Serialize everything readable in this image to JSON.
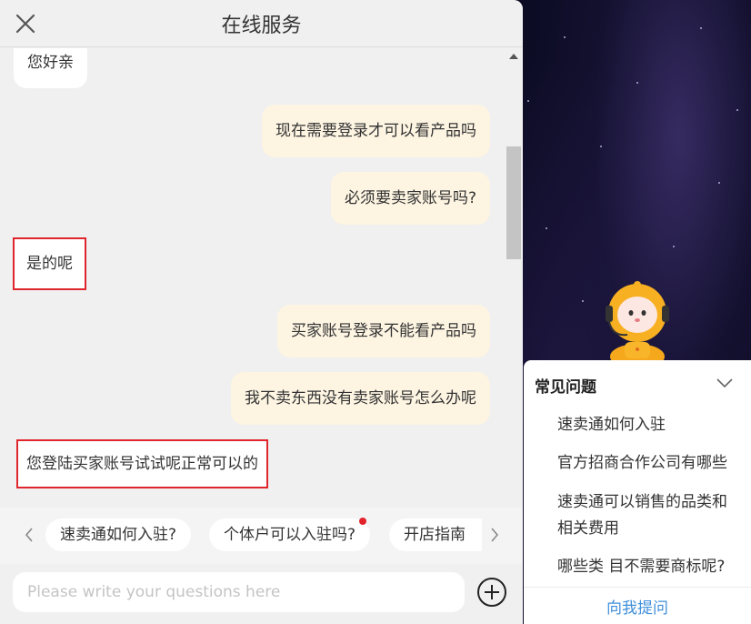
{
  "header": {
    "title": "在线服务",
    "close_icon": "close-icon"
  },
  "messages": [
    {
      "side": "left",
      "text": "您好亲",
      "highlighted": false
    },
    {
      "side": "right",
      "text": "现在需要登录才可以看产品吗",
      "highlighted": false
    },
    {
      "side": "right",
      "text": "必须要卖家账号吗?",
      "highlighted": false
    },
    {
      "side": "left",
      "text": "是的呢",
      "highlighted": true
    },
    {
      "side": "right",
      "text": "买家账号登录不能看产品吗",
      "highlighted": false
    },
    {
      "side": "right",
      "text": "我不卖东西没有卖家账号怎么办呢",
      "highlighted": false
    },
    {
      "side": "left",
      "text": "您登陆买家账号试试呢正常可以的",
      "highlighted": true
    }
  ],
  "quick_replies": {
    "prev_icon": "chevron-left-icon",
    "next_icon": "chevron-right-icon",
    "items": [
      {
        "label": "速卖通如何入驻?",
        "badge": false
      },
      {
        "label": "个体户可以入驻吗?",
        "badge": true
      },
      {
        "label": "开店指南",
        "badge": false
      }
    ]
  },
  "composer": {
    "placeholder": "Please write your questions here",
    "add_icon": "plus-circle-icon"
  },
  "faq": {
    "title": "常见问题",
    "items": [
      "速卖通如何入驻",
      "官方招商合作公司有哪些",
      "速卖通可以销售的品类和相关费用",
      "哪些类 目不需要商标呢?"
    ],
    "ask_label": "向我提问"
  },
  "colors": {
    "user_bubble": "#fdf4e2",
    "agent_bubble": "#ffffff",
    "highlight": "#e0262d",
    "link": "#3f8fdb",
    "badge": "#e3232c"
  }
}
